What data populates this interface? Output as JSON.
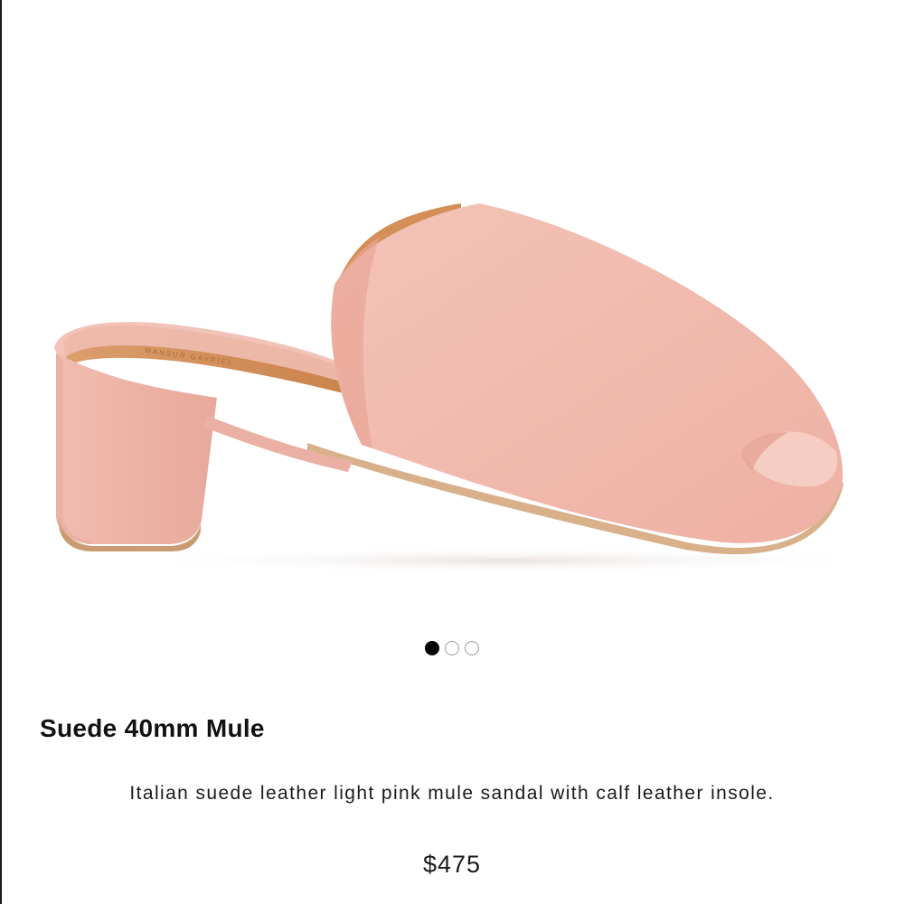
{
  "product": {
    "image_alt": "light pink suede mule sandal",
    "insole_brand_mark": "MANSUR GAVRIEL",
    "title": "Suede 40mm Mule",
    "description": "Italian suede leather light pink mule sandal with calf leather insole.",
    "price": "$475"
  },
  "carousel": {
    "total": 3,
    "active_index": 0,
    "dots": [
      {
        "label": "image 1",
        "active": true
      },
      {
        "label": "image 2",
        "active": false
      },
      {
        "label": "image 3",
        "active": false
      }
    ]
  },
  "colors": {
    "suede": "#f1b9ad",
    "suede_shadow": "#e3a597",
    "insole": "#d99762",
    "sole_edge": "#caa079",
    "active_dot": "#000000",
    "inactive_dot_border": "#9a9a9a"
  }
}
